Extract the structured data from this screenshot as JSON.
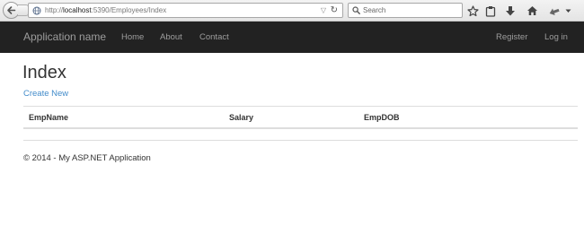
{
  "browser": {
    "url_prefix": "http://",
    "url_host": "localhost",
    "url_rest": ":5390/Employees/Index",
    "search_placeholder": "Search"
  },
  "navbar": {
    "brand": "Application name",
    "links": [
      "Home",
      "About",
      "Contact"
    ],
    "right_links": [
      "Register",
      "Log in"
    ],
    "background": "#222222",
    "link_color": "#9d9d9d"
  },
  "main": {
    "title": "Index",
    "create_link": "Create New",
    "link_color": "#428bca",
    "table": {
      "columns": [
        "EmpName",
        "Salary",
        "EmpDOB"
      ],
      "rows": []
    }
  },
  "footer": {
    "text": "© 2014 - My ASP.NET Application"
  },
  "icons": [
    "back-arrow-icon",
    "forward-icon",
    "globe-icon",
    "dropdown-arrow-icon",
    "reload-icon",
    "search-icon",
    "star-icon",
    "clipboard-icon",
    "download-icon",
    "home-icon",
    "send-icon",
    "menu-chevron-icon"
  ]
}
